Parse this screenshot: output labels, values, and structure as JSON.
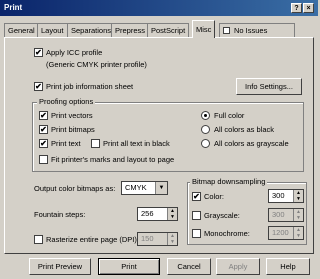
{
  "window": {
    "title": "Print",
    "help_btn": "?",
    "close_btn": "×"
  },
  "tabs": [
    "General",
    "Layout",
    "Separations",
    "Prepress",
    "PostScript",
    "Misc",
    "No Issues"
  ],
  "icc": {
    "label": "Apply ICC profile",
    "checked": "✔",
    "profile": "(Generic CMYK printer profile)"
  },
  "job_sheet": {
    "label": "Print job information sheet",
    "checked": "✔",
    "button": "Info Settings..."
  },
  "proofing": {
    "title": "Proofing options",
    "vectors": "Print vectors",
    "bitmaps": "Print bitmaps",
    "text": "Print text",
    "all_text_black": "Print all text in black",
    "fit_marks": "Fit printer's marks and layout to page",
    "full_color": "Full color",
    "all_black": "All colors as black",
    "all_gray": "All colors as grayscale",
    "check": "✔"
  },
  "output": {
    "label": "Output color bitmaps as:",
    "value": "CMYK"
  },
  "fountain": {
    "label": "Fountain steps:",
    "value": "256"
  },
  "rasterize": {
    "label": "Rasterize entire page (DPI):",
    "value": "150"
  },
  "downsampling": {
    "title": "Bitmap downsampling",
    "color": "Color:",
    "color_value": "300",
    "grayscale": "Grayscale:",
    "grayscale_value": "300",
    "mono": "Monochrome:",
    "mono_value": "1200",
    "check": "✔"
  },
  "buttons": {
    "preview": "Print Preview",
    "print": "Print",
    "cancel": "Cancel",
    "apply": "Apply",
    "help": "Help"
  }
}
